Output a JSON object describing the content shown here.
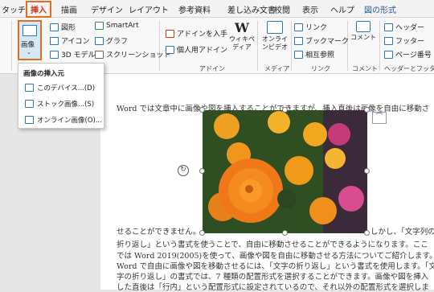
{
  "tabs": [
    "タッチ",
    "挿入",
    "描画",
    "デザイン",
    "レイアウト",
    "参考資料",
    "差し込み文書",
    "校閲",
    "表示",
    "ヘルプ",
    "図の形式"
  ],
  "ribbon": {
    "image_label": "画像",
    "shapes_label": "図形",
    "icons_label": "アイコン",
    "model3d_label": "3D モデル",
    "smartart_label": "SmartArt",
    "graph_label": "グラフ",
    "screenshot_label": "スクリーンショット",
    "addin_get_label": "アドインを入手",
    "my_addins_label": "個人用アドイン",
    "wiki_label": "ウィキペディア",
    "online_video_label": "オンラインビデオ",
    "link_label": "リンク",
    "bookmark_label": "ブックマーク",
    "crossref_label": "相互参照",
    "comment_label": "コメント",
    "header_label": "ヘッダー",
    "footer_label": "フッター",
    "pagenum_label": "ページ番号",
    "group_addin": "アドイン",
    "group_media": "メディア",
    "group_link": "リンク",
    "group_comment": "コメント",
    "group_hf": "ヘッダーとフッター"
  },
  "dropdown": {
    "title": "画像の挿入元",
    "items": [
      "このデバイス...(D)",
      "ストック画像...(S)",
      "オンライン画像(O)..."
    ]
  },
  "doc": {
    "line1": "Word では文章中に画像や図を挿入することができますが、挿入直後は画像を自由に移動さ",
    "line2": "せることができません。",
    "line2b": "しかし、「文字列の",
    "line3": "折り返し」という書式を使うことで、自由に移動させることができるようになります。ここ",
    "line4": "では Word 2019(2005)を使って、画像や図を自由に移動させる方法についてご紹介します。",
    "line5": "Word で自由に画像や図を移動させるには、「文字の折り返し」という書式を使用します。「文",
    "line6": "字の折り返し」の書式では、7 種類の配置形式を選択することができます。画像や図を挿入",
    "line7": "した直後は「行内」という配置形式に設定されているので、それ以外の配置形式を選択しま"
  }
}
